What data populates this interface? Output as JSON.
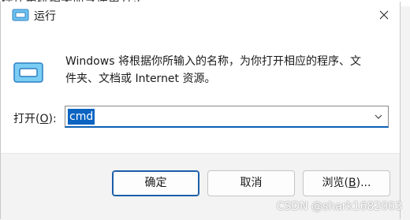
{
  "background": {
    "partial_text": "操作系统相关命令使用方法"
  },
  "window": {
    "title": "运行",
    "close_icon": "close-icon"
  },
  "content": {
    "description_line1": "Windows 将根据你所输入的名称，为你打开相应的程序、文",
    "description_line2": "件夹、文档或 Internet 资源。",
    "open_label_prefix": "打开(",
    "open_label_accel": "O",
    "open_label_suffix": "):",
    "command_value": "cmd"
  },
  "buttons": {
    "ok": "确定",
    "cancel": "取消",
    "browse_prefix": "浏览(",
    "browse_accel": "B",
    "browse_suffix": ")..."
  },
  "watermark": "CSDN @shark1682003",
  "colors": {
    "accent": "#0a64c2",
    "window_bg": "#ffffff",
    "footer_bg": "#f3f3f3"
  }
}
